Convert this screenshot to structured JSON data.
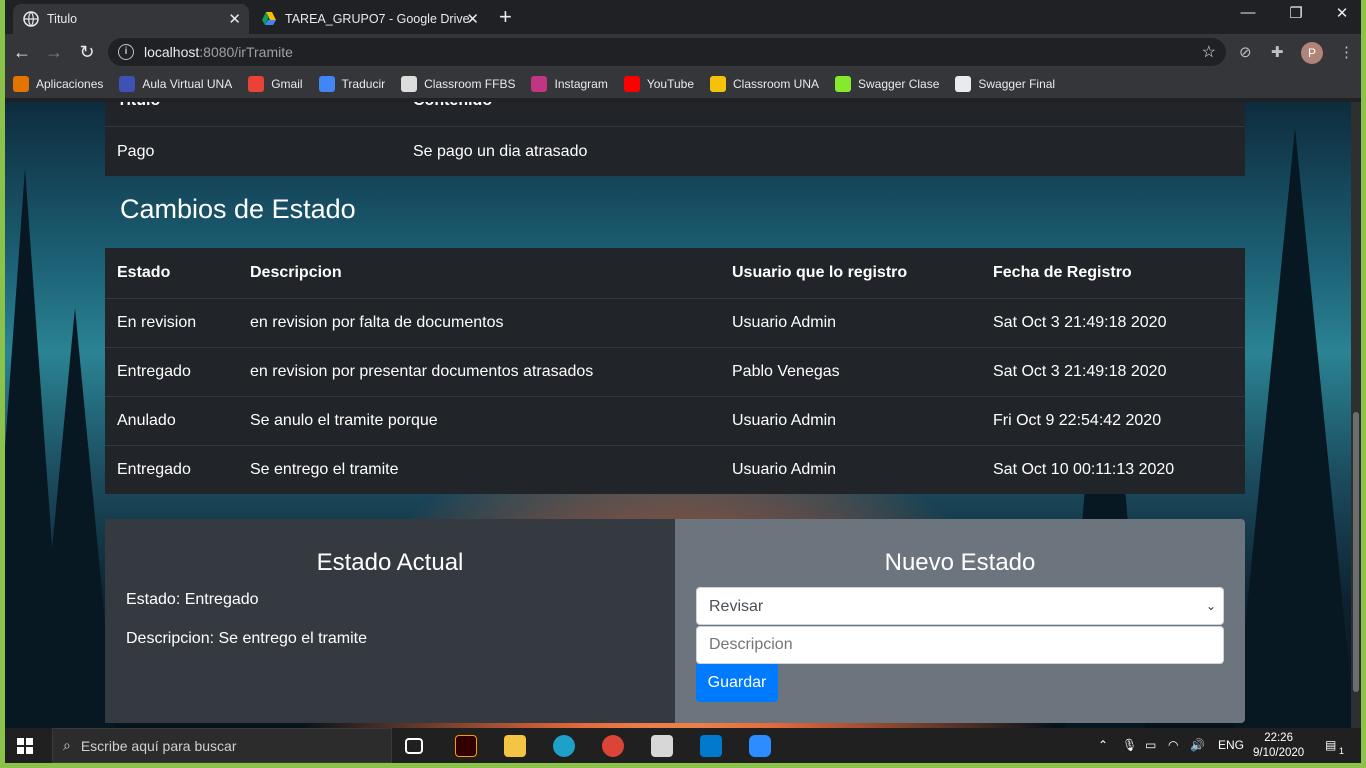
{
  "browser": {
    "tabs": [
      {
        "title": "Titulo",
        "active": true
      },
      {
        "title": "TAREA_GRUPO7 - Google Drive",
        "active": false
      }
    ],
    "url_host": "localhost",
    "url_rest": ":8080/irTramite",
    "bookmarks": [
      {
        "label": "Aplicaciones",
        "color": "#e37400"
      },
      {
        "label": "Aula Virtual UNA",
        "color": "#3f51b5"
      },
      {
        "label": "Gmail",
        "color": "#ea4335"
      },
      {
        "label": "Traducir",
        "color": "#4285f4"
      },
      {
        "label": "Classroom FFBS",
        "color": "#dddddd"
      },
      {
        "label": "Instagram",
        "color": "#c13584"
      },
      {
        "label": "YouTube",
        "color": "#ff0000"
      },
      {
        "label": "Classroom UNA",
        "color": "#f4c20d"
      },
      {
        "label": "Swagger Clase",
        "color": "#85ea2d"
      },
      {
        "label": "Swagger Final",
        "color": "#e8eaed"
      }
    ],
    "profile_initial": "P"
  },
  "contenido_table": {
    "headers": [
      "Titulo",
      "Contenido"
    ],
    "rows": [
      [
        "Pago",
        "Se pago un dia atrasado"
      ]
    ]
  },
  "cambios": {
    "title": "Cambios de Estado",
    "headers": [
      "Estado",
      "Descripcion",
      "Usuario que lo registro",
      "Fecha de Registro"
    ],
    "rows": [
      [
        "En revision",
        "en revision por falta de documentos",
        "Usuario Admin",
        "Sat Oct 3 21:49:18 2020"
      ],
      [
        "Entregado",
        "en revision por presentar documentos atrasados",
        "Pablo Venegas",
        "Sat Oct 3 21:49:18 2020"
      ],
      [
        "Anulado",
        "Se anulo el tramite porque",
        "Usuario Admin",
        "Fri Oct 9 22:54:42 2020"
      ],
      [
        "Entregado",
        "Se entrego el tramite",
        "Usuario Admin",
        "Sat Oct 10 00:11:13 2020"
      ]
    ]
  },
  "estado_actual": {
    "title": "Estado Actual",
    "estado": "Estado: Entregado",
    "descripcion": "Descripcion: Se entrego el tramite"
  },
  "nuevo_estado": {
    "title": "Nuevo Estado",
    "selected": "Revisar",
    "placeholder": "Descripcion",
    "button": "Guardar"
  },
  "taskbar": {
    "search_placeholder": "Escribe aquí para buscar",
    "lang": "ENG",
    "time": "22:26",
    "date": "9/10/2020",
    "notifications": "1"
  }
}
